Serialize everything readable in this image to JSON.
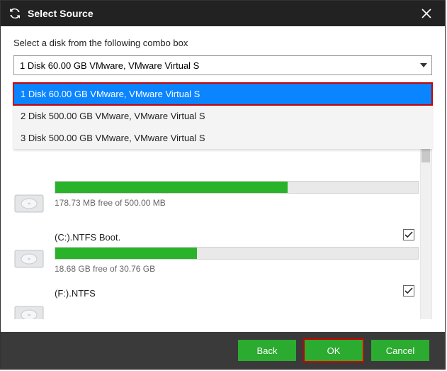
{
  "window": {
    "title": "Select Source"
  },
  "prompt": "Select a disk from the following combo box",
  "combo": {
    "selected_label": "1 Disk 60.00 GB VMware,  VMware Virtual S",
    "options": [
      {
        "label": "1 Disk 60.00 GB VMware,  VMware Virtual S",
        "selected": true
      },
      {
        "label": "2 Disk 500.00 GB VMware,  VMware Virtual S",
        "selected": false
      },
      {
        "label": "3 Disk 500.00 GB VMware,  VMware Virtual S",
        "selected": false
      }
    ]
  },
  "partitions": [
    {
      "name": "",
      "free_text": "178.73 MB free of 500.00 MB",
      "fill_pct": 64,
      "checked": null
    },
    {
      "name": "(C:).NTFS Boot.",
      "free_text": "18.68 GB free of 30.76 GB",
      "fill_pct": 39,
      "checked": true
    },
    {
      "name": "(F:).NTFS",
      "free_text": "",
      "fill_pct": 0,
      "checked": true
    }
  ],
  "buttons": {
    "back": "Back",
    "ok": "OK",
    "cancel": "Cancel"
  },
  "colors": {
    "accent_green": "#2bab2f",
    "progress_green": "#29b32a",
    "select_blue": "#0a84ff",
    "highlight_red": "#c00",
    "titlebar": "#222"
  }
}
